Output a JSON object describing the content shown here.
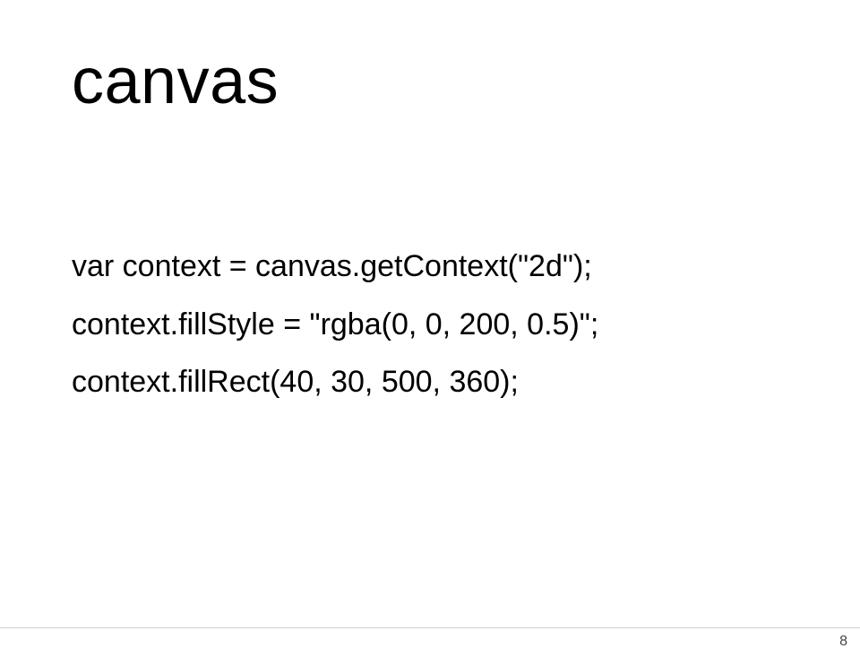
{
  "slide": {
    "title": "canvas",
    "code": {
      "line1": "var context = canvas.getContext(\"2d\");",
      "line2": "",
      "line3": "context.fillStyle = \"rgba(0, 0, 200, 0.5)\";",
      "line4": "context.fillRect(40, 30, 500, 360);"
    },
    "page_number": "8"
  }
}
